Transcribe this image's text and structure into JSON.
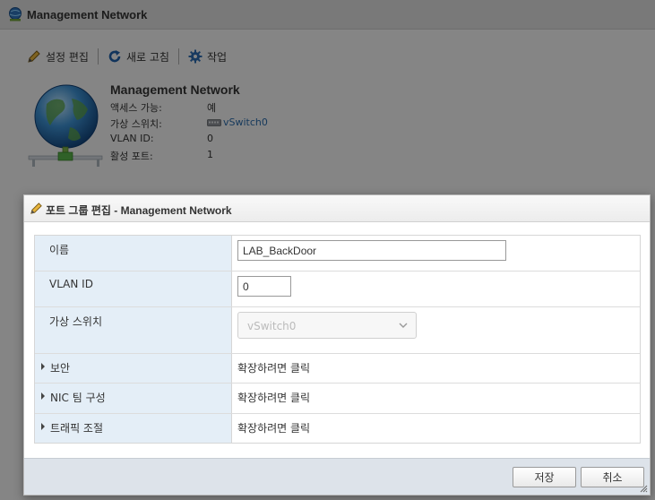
{
  "window": {
    "title": "Management Network",
    "toolbar": {
      "edit_settings": "설정 편집",
      "refresh": "새로 고침",
      "actions": "작업"
    },
    "network": {
      "name": "Management Network",
      "properties": [
        {
          "key": "액세스 가능:",
          "value": "예"
        },
        {
          "key": "가상 스위치:",
          "value": "vSwitch0"
        },
        {
          "key": "VLAN ID:",
          "value": "0"
        },
        {
          "key": "활성 포트:",
          "value": "1"
        }
      ]
    }
  },
  "dialog": {
    "title": "포트 그룹 편집 - Management Network",
    "fields": {
      "name": {
        "label": "이름",
        "value": "LAB_BackDoor"
      },
      "vlan": {
        "label": "VLAN ID",
        "value": "0"
      },
      "vswitch": {
        "label": "가상 스위치",
        "value": "vSwitch0"
      },
      "security": {
        "label": "보안",
        "value": "확장하려면 클릭"
      },
      "nic_teaming": {
        "label": "NIC 팀 구성",
        "value": "확장하려면 클릭"
      },
      "traffic_shaping": {
        "label": "트래픽 조절",
        "value": "확장하려면 클릭"
      }
    },
    "buttons": {
      "save": "저장",
      "cancel": "취소"
    }
  },
  "icons": {
    "app": "network-icon",
    "edit": "pencil-icon",
    "refresh": "refresh-icon",
    "actions": "gear-icon",
    "switch": "switch-icon",
    "globe": "globe-network-icon",
    "expand": "triangle-right-icon",
    "dropdown": "chevron-down-icon"
  },
  "colors": {
    "label_bg": "#e4eef7",
    "link": "#2a6aa8",
    "footer_bg": "#dde3ea",
    "overlay": "#7f7f7f"
  }
}
